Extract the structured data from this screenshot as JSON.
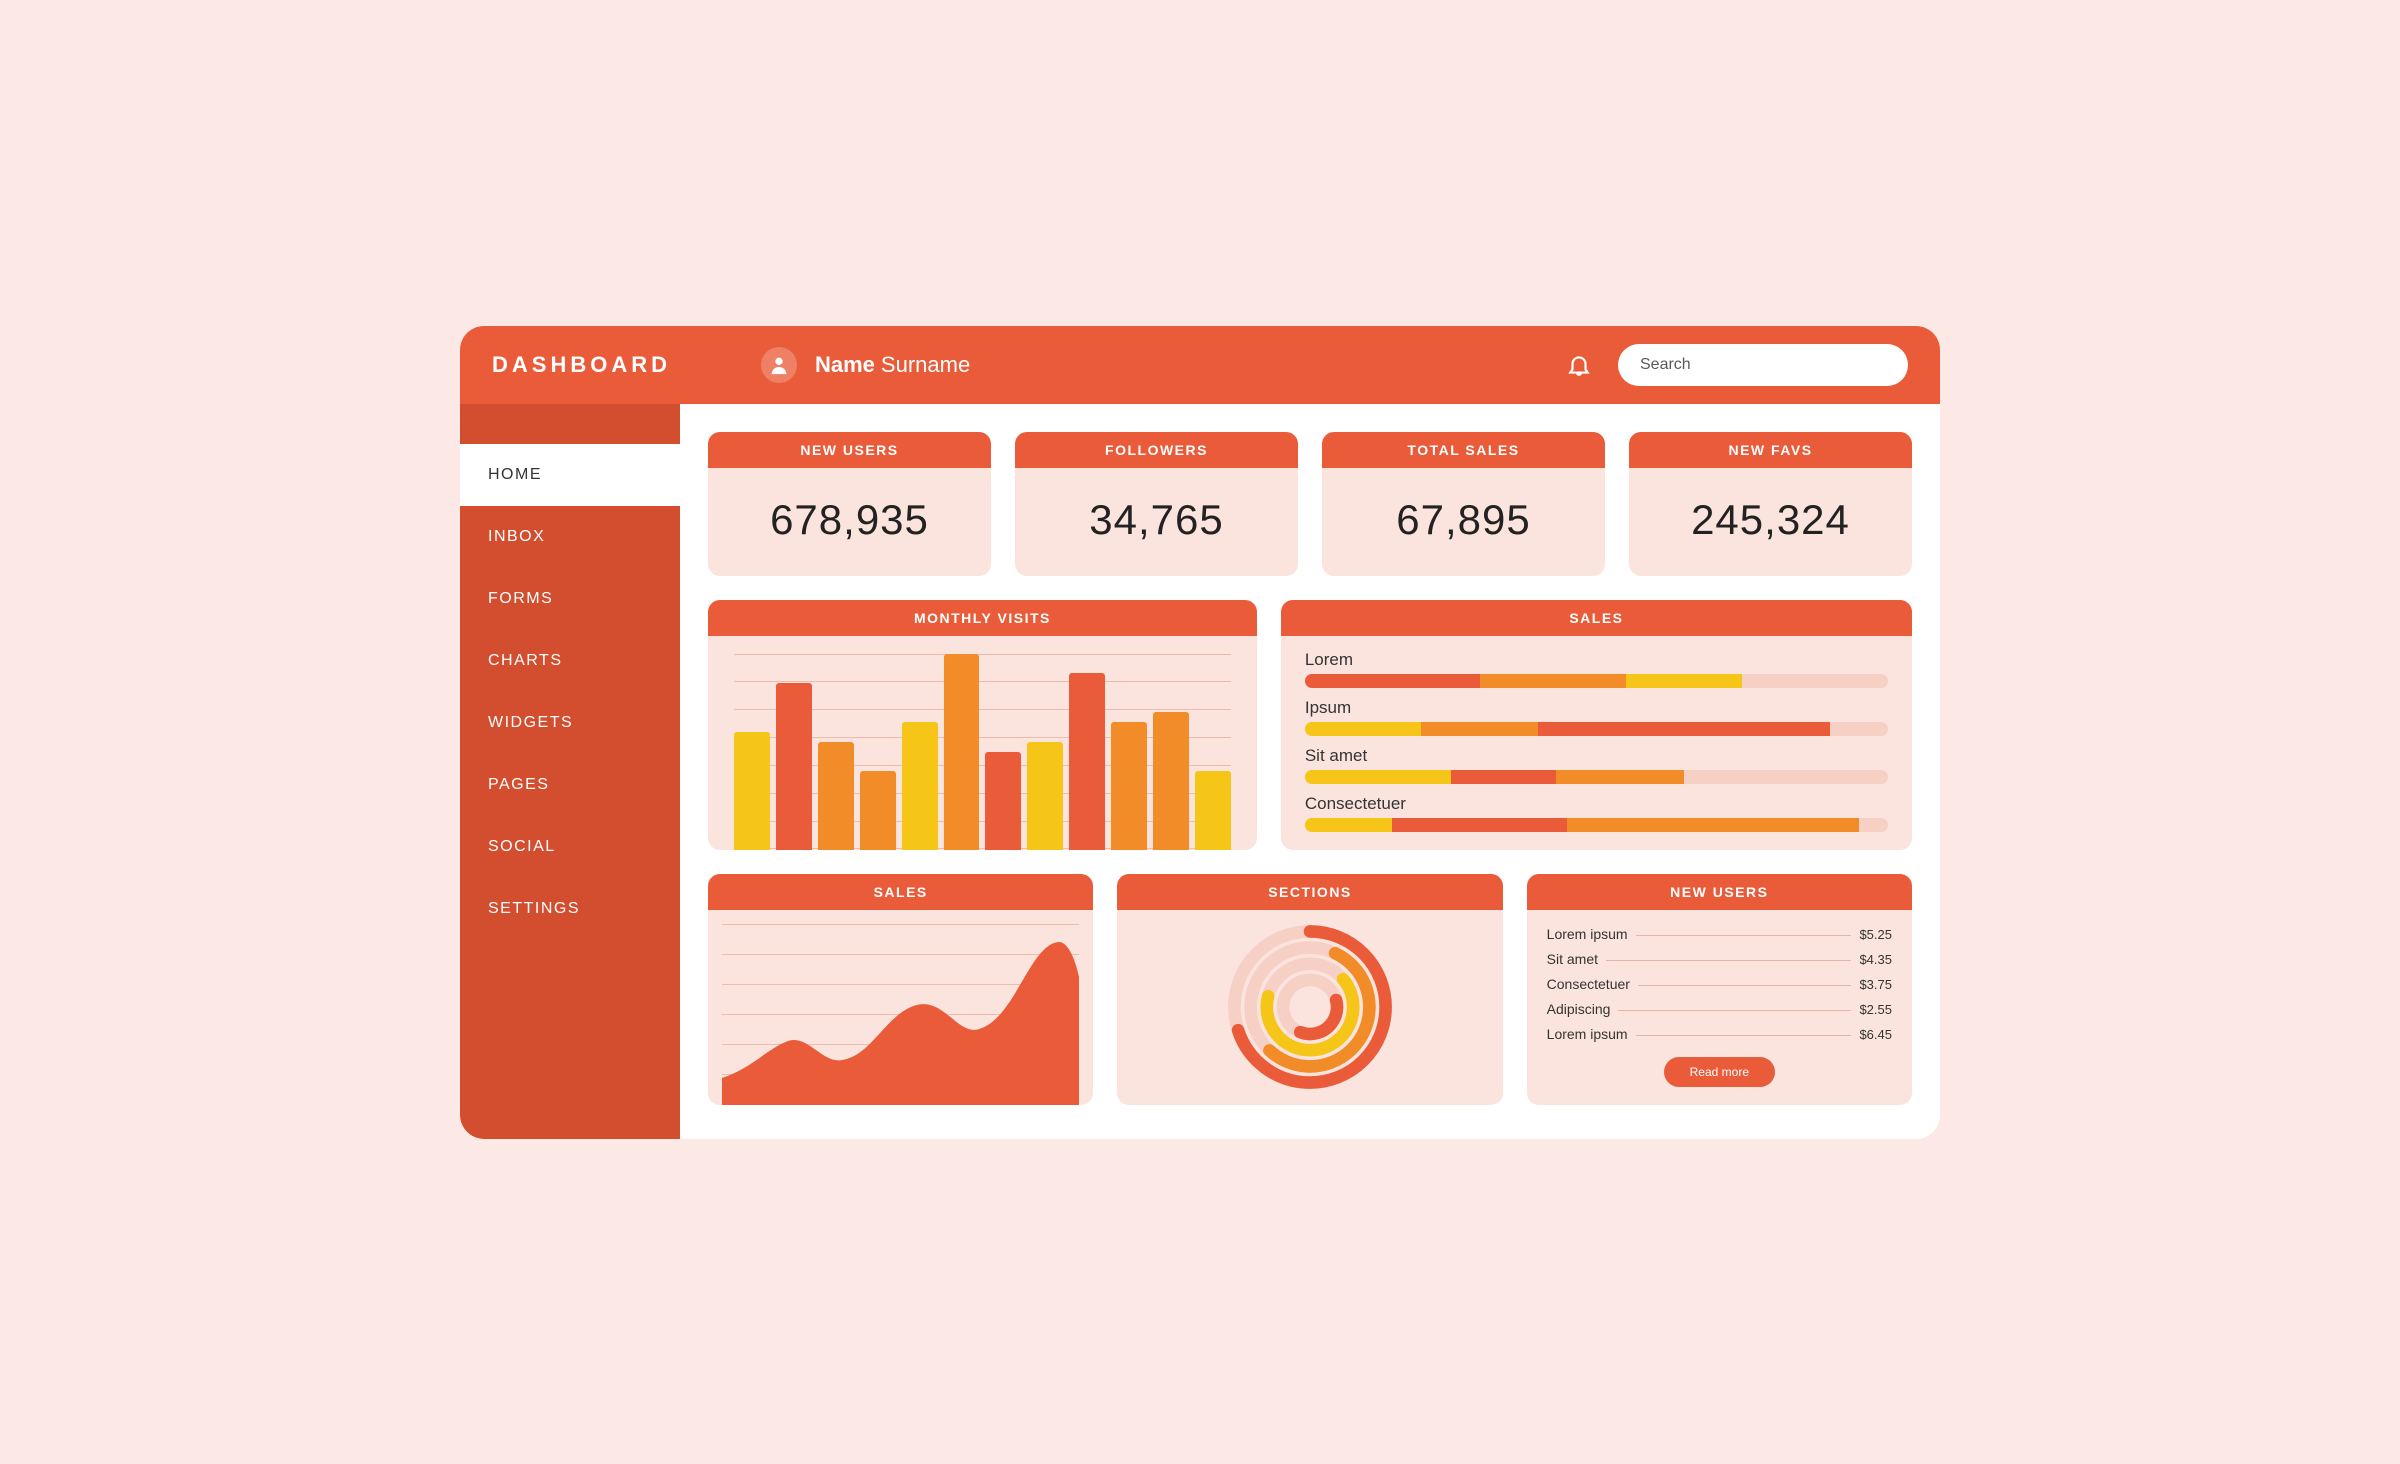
{
  "colors": {
    "red": "#EA5B3A",
    "darkred": "#D34D2F",
    "orange": "#F28C28",
    "yellow": "#F5C518",
    "pink": "#F6CFC5"
  },
  "header": {
    "logo": "DASHBOARD",
    "user_first": "Name",
    "user_last": "Surname",
    "search_placeholder": "Search"
  },
  "sidebar": {
    "items": [
      {
        "label": "HOME",
        "active": true
      },
      {
        "label": "INBOX",
        "active": false
      },
      {
        "label": "FORMS",
        "active": false
      },
      {
        "label": "CHARTS",
        "active": false
      },
      {
        "label": "WIDGETS",
        "active": false
      },
      {
        "label": "PAGES",
        "active": false
      },
      {
        "label": "SOCIAL",
        "active": false
      },
      {
        "label": "SETTINGS",
        "active": false
      }
    ]
  },
  "kpis": [
    {
      "title": "NEW USERS",
      "value": "678,935"
    },
    {
      "title": "FOLLOWERS",
      "value": "34,765"
    },
    {
      "title": "TOTAL SALES",
      "value": "67,895"
    },
    {
      "title": "NEW FAVS",
      "value": "245,324"
    }
  ],
  "monthly_visits": {
    "title": "MONTHLY VISITS"
  },
  "sales_bars": {
    "title": "SALES",
    "rows": [
      {
        "label": "Lorem"
      },
      {
        "label": "Ipsum"
      },
      {
        "label": "Sit amet"
      },
      {
        "label": "Consectetuer"
      }
    ]
  },
  "sales_area": {
    "title": "SALES"
  },
  "sections": {
    "title": "SECTIONS"
  },
  "new_users_list": {
    "title": "NEW USERS",
    "rows": [
      {
        "label": "Lorem ipsum",
        "price": "$5.25"
      },
      {
        "label": "Sit amet",
        "price": "$4.35"
      },
      {
        "label": "Consectetuer",
        "price": "$3.75"
      },
      {
        "label": "Adipiscing",
        "price": "$2.55"
      },
      {
        "label": "Lorem ipsum",
        "price": "$6.45"
      }
    ],
    "button": "Read more"
  },
  "chart_data": [
    {
      "type": "bar",
      "title": "MONTHLY VISITS",
      "ylim": [
        0,
        100
      ],
      "series": [
        {
          "values": [
            60,
            85,
            55,
            40,
            65,
            100,
            50,
            55,
            90,
            65,
            70,
            40
          ],
          "colors": [
            "yellow",
            "red",
            "orange",
            "orange",
            "yellow",
            "orange",
            "red",
            "yellow",
            "red",
            "orange",
            "orange",
            "yellow"
          ]
        }
      ]
    },
    {
      "type": "bar",
      "title": "SALES",
      "orientation": "horizontal",
      "categories": [
        "Lorem",
        "Ipsum",
        "Sit amet",
        "Consectetuer"
      ],
      "series_stacked": true,
      "data": [
        {
          "category": "Lorem",
          "segments": [
            {
              "color": "red",
              "pct": 30
            },
            {
              "color": "orange",
              "pct": 25
            },
            {
              "color": "yellow",
              "pct": 20
            }
          ]
        },
        {
          "category": "Ipsum",
          "segments": [
            {
              "color": "yellow",
              "pct": 20
            },
            {
              "color": "orange",
              "pct": 20
            },
            {
              "color": "red",
              "pct": 50
            }
          ]
        },
        {
          "category": "Sit amet",
          "segments": [
            {
              "color": "yellow",
              "pct": 25
            },
            {
              "color": "red",
              "pct": 18
            },
            {
              "color": "orange",
              "pct": 22
            }
          ]
        },
        {
          "category": "Consectetuer",
          "segments": [
            {
              "color": "yellow",
              "pct": 15
            },
            {
              "color": "red",
              "pct": 30
            },
            {
              "color": "orange",
              "pct": 50
            }
          ]
        }
      ]
    },
    {
      "type": "area",
      "title": "SALES",
      "ylim": [
        0,
        100
      ],
      "values": [
        15,
        35,
        25,
        55,
        40,
        80,
        60,
        95,
        70
      ]
    },
    {
      "type": "pie",
      "title": "SECTIONS",
      "rings": [
        {
          "color": "red",
          "pct": 70
        },
        {
          "color": "orange",
          "pct": 55
        },
        {
          "color": "yellow",
          "pct": 65
        },
        {
          "color": "red",
          "pct": 35
        }
      ]
    }
  ]
}
